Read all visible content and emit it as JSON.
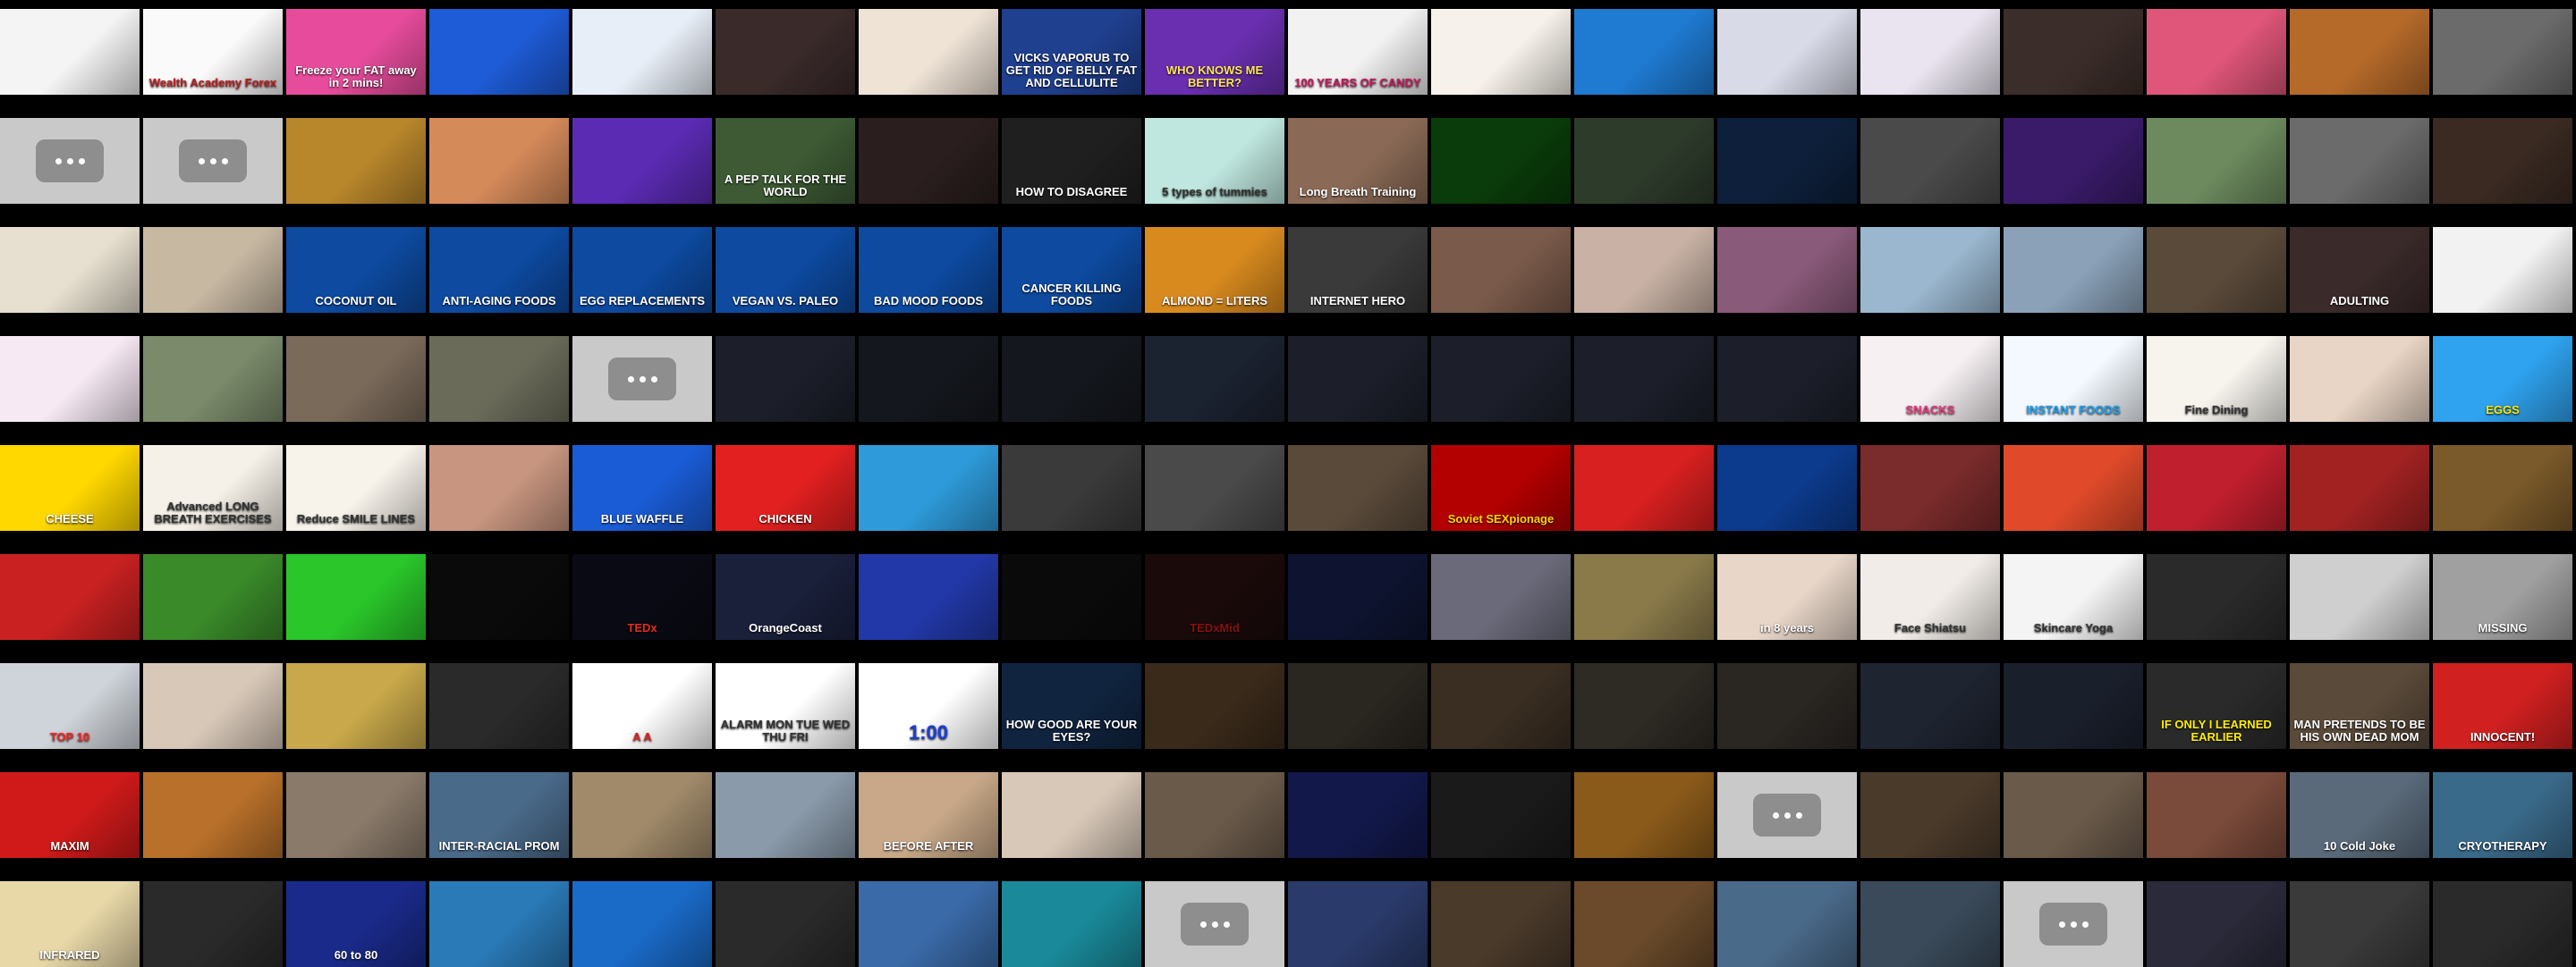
{
  "rows": [
    [
      {
        "kind": "img",
        "bg": "#f4f4f4",
        "fg": "#1a1a1a",
        "cap": "",
        "accent": "#c0392b"
      },
      {
        "kind": "img",
        "bg": "#fafafa",
        "fg": "#b71c1c",
        "cap": "Wealth Academy Forex"
      },
      {
        "kind": "img",
        "bg": "#e74c9c",
        "fg": "#ffffff",
        "cap": "Freeze your FAT away in 2 mins!"
      },
      {
        "kind": "img",
        "bg": "#1e5bd6",
        "fg": "#ffffff",
        "cap": ""
      },
      {
        "kind": "img",
        "bg": "#e8eef7",
        "fg": "#1e5bd6",
        "cap": ""
      },
      {
        "kind": "img",
        "bg": "#3a2a2a",
        "fg": "#ffffff",
        "cap": ""
      },
      {
        "kind": "img",
        "bg": "#efe3d6",
        "fg": "#5a3a1a",
        "cap": ""
      },
      {
        "kind": "img",
        "bg": "#1f3f8f",
        "fg": "#ffffff",
        "cap": "VICKS VAPORUB TO GET RID OF BELLY FAT AND CELLULITE"
      },
      {
        "kind": "img",
        "bg": "#6a2fb0",
        "fg": "#ffe45c",
        "cap": "WHO KNOWS ME BETTER?"
      },
      {
        "kind": "img",
        "bg": "#f2f2f2",
        "fg": "#c2185b",
        "cap": "100 YEARS OF CANDY"
      },
      {
        "kind": "img",
        "bg": "#f6f1ea",
        "fg": "#333333",
        "cap": ""
      },
      {
        "kind": "img",
        "bg": "#1f7ad1",
        "fg": "#ffffff",
        "cap": ""
      },
      {
        "kind": "img",
        "bg": "#d8dae8",
        "fg": "#222222",
        "cap": ""
      },
      {
        "kind": "img",
        "bg": "#e9e4ef",
        "fg": "#222222",
        "cap": ""
      },
      {
        "kind": "img",
        "bg": "#3b2d2a",
        "fg": "#ffd400",
        "cap": ""
      },
      {
        "kind": "img",
        "bg": "#e0567a",
        "fg": "#ffffff",
        "cap": ""
      },
      {
        "kind": "img",
        "bg": "#b56a2a",
        "fg": "#ffffff",
        "cap": ""
      },
      {
        "kind": "img",
        "bg": "#6b6b6b",
        "fg": "#ffffff",
        "cap": ""
      }
    ],
    [
      {
        "kind": "placeholder"
      },
      {
        "kind": "placeholder"
      },
      {
        "kind": "img",
        "bg": "#b8862b",
        "fg": "#ffffff",
        "cap": ""
      },
      {
        "kind": "img",
        "bg": "#d58a5a",
        "fg": "#ffffff",
        "cap": ""
      },
      {
        "kind": "img",
        "bg": "#5b2bb3",
        "fg": "#ffffff",
        "cap": ""
      },
      {
        "kind": "img",
        "bg": "#3d5a34",
        "fg": "#ffffff",
        "cap": "A PEP TALK FOR THE WORLD"
      },
      {
        "kind": "img",
        "bg": "#2a1e1e",
        "fg": "#ff7a00",
        "cap": ""
      },
      {
        "kind": "img",
        "bg": "#1f1f1f",
        "fg": "#ffffff",
        "cap": "HOW TO DISAGREE"
      },
      {
        "kind": "img",
        "bg": "#bfe7df",
        "fg": "#333333",
        "cap": "5 types of tummies"
      },
      {
        "kind": "img",
        "bg": "#8a6a56",
        "fg": "#ffffff",
        "cap": "Long Breath Training"
      },
      {
        "kind": "img",
        "bg": "#0a3b0a",
        "fg": "#37ff37",
        "cap": ""
      },
      {
        "kind": "img",
        "bg": "#2d3b2b",
        "fg": "#ffffff",
        "cap": ""
      },
      {
        "kind": "img",
        "bg": "#0d1f3a",
        "fg": "#6fb3ff",
        "cap": ""
      },
      {
        "kind": "img",
        "bg": "#4a4a4a",
        "fg": "#ffffff",
        "cap": ""
      },
      {
        "kind": "img",
        "bg": "#3a1b6a",
        "fg": "#c59bff",
        "cap": ""
      },
      {
        "kind": "img",
        "bg": "#6c8a5e",
        "fg": "#ffffff",
        "cap": ""
      },
      {
        "kind": "img",
        "bg": "#6b6b6b",
        "fg": "#ffffff",
        "cap": ""
      },
      {
        "kind": "img",
        "bg": "#3a2a22",
        "fg": "#ffffff",
        "cap": ""
      }
    ],
    [
      {
        "kind": "img",
        "bg": "#e7e0d0",
        "fg": "#333333",
        "cap": ""
      },
      {
        "kind": "img",
        "bg": "#c7b8a2",
        "fg": "#333333",
        "cap": ""
      },
      {
        "kind": "img",
        "bg": "#0d4aa0",
        "fg": "#ffffff",
        "cap": "COCONUT OIL"
      },
      {
        "kind": "img",
        "bg": "#0d4aa0",
        "fg": "#ffffff",
        "cap": "ANTI-AGING FOODS"
      },
      {
        "kind": "img",
        "bg": "#0d4aa0",
        "fg": "#ffffff",
        "cap": "EGG REPLACEMENTS"
      },
      {
        "kind": "img",
        "bg": "#0d4aa0",
        "fg": "#ffffff",
        "cap": "VEGAN VS. PALEO"
      },
      {
        "kind": "img",
        "bg": "#0d4aa0",
        "fg": "#ffffff",
        "cap": "BAD MOOD FOODS"
      },
      {
        "kind": "img",
        "bg": "#0d4aa0",
        "fg": "#ffffff",
        "cap": "CANCER KILLING FOODS"
      },
      {
        "kind": "img",
        "bg": "#d88a1e",
        "fg": "#ffffff",
        "cap": "ALMOND = LITERS"
      },
      {
        "kind": "img",
        "bg": "#3a3a3a",
        "fg": "#ffffff",
        "cap": "INTERNET HERO"
      },
      {
        "kind": "img",
        "bg": "#7a5a4a",
        "fg": "#ffffff",
        "cap": ""
      },
      {
        "kind": "img",
        "bg": "#c9b2a5",
        "fg": "#ffffff",
        "cap": ""
      },
      {
        "kind": "img",
        "bg": "#8a5a7a",
        "fg": "#ffffff",
        "cap": ""
      },
      {
        "kind": "img",
        "bg": "#9ab7cf",
        "fg": "#ffffff",
        "cap": ""
      },
      {
        "kind": "img",
        "bg": "#8aa1b8",
        "fg": "#ffffff",
        "cap": ""
      },
      {
        "kind": "img",
        "bg": "#5a4a3a",
        "fg": "#ffffff",
        "cap": ""
      },
      {
        "kind": "img",
        "bg": "#3a2a2a",
        "fg": "#ffffff",
        "cap": "ADULTING"
      },
      {
        "kind": "img",
        "bg": "#f2f2f2",
        "fg": "#d00000",
        "cap": ""
      }
    ],
    [
      {
        "kind": "img",
        "bg": "#f6e9f4",
        "fg": "#c2185b",
        "cap": ""
      },
      {
        "kind": "img",
        "bg": "#7a8a6a",
        "fg": "#ffffff",
        "cap": ""
      },
      {
        "kind": "img",
        "bg": "#7a6a5a",
        "fg": "#ffffff",
        "cap": ""
      },
      {
        "kind": "img",
        "bg": "#6b6b5a",
        "fg": "#ffffff",
        "cap": ""
      },
      {
        "kind": "placeholder"
      },
      {
        "kind": "img",
        "bg": "#1c1f2a",
        "fg": "#ffffff",
        "cap": ""
      },
      {
        "kind": "img",
        "bg": "#14171d",
        "fg": "#ffffff",
        "cap": ""
      },
      {
        "kind": "img",
        "bg": "#14171d",
        "fg": "#ffffff",
        "cap": ""
      },
      {
        "kind": "img",
        "bg": "#1b2230",
        "fg": "#ffffff",
        "cap": ""
      },
      {
        "kind": "img",
        "bg": "#1c1f2a",
        "fg": "#ffffff",
        "cap": ""
      },
      {
        "kind": "img",
        "bg": "#1c1f2a",
        "fg": "#ffffff",
        "cap": ""
      },
      {
        "kind": "img",
        "bg": "#1c1f2a",
        "fg": "#ffffff",
        "cap": ""
      },
      {
        "kind": "img",
        "bg": "#1c1f2a",
        "fg": "#ffffff",
        "cap": ""
      },
      {
        "kind": "img",
        "bg": "#f6f0f3",
        "fg": "#e73a7d",
        "cap": "SNACKS"
      },
      {
        "kind": "img",
        "bg": "#f3f9ff",
        "fg": "#1da1f2",
        "cap": "INSTANT FOODS"
      },
      {
        "kind": "img",
        "bg": "#f7f4ee",
        "fg": "#333333",
        "cap": "Fine Dining"
      },
      {
        "kind": "img",
        "bg": "#e9d5c5",
        "fg": "#333333",
        "cap": ""
      },
      {
        "kind": "img",
        "bg": "#2fa3f0",
        "fg": "#ffea00",
        "cap": "EGGS"
      }
    ],
    [
      {
        "kind": "img",
        "bg": "#ffd800",
        "fg": "#ffffff",
        "cap": "CHEESE"
      },
      {
        "kind": "img",
        "bg": "#f6f1e8",
        "fg": "#333333",
        "cap": "Advanced LONG BREATH EXERCISES"
      },
      {
        "kind": "img",
        "bg": "#f7f2ea",
        "fg": "#333333",
        "cap": "Reduce SMILE LINES"
      },
      {
        "kind": "img",
        "bg": "#c89680",
        "fg": "#ffffff",
        "cap": ""
      },
      {
        "kind": "img",
        "bg": "#1a5cd6",
        "fg": "#ffffff",
        "cap": "BLUE WAFFLE"
      },
      {
        "kind": "img",
        "bg": "#e32020",
        "fg": "#ffffff",
        "cap": "CHICKEN"
      },
      {
        "kind": "img",
        "bg": "#2e9ad9",
        "fg": "#ffffff",
        "cap": ""
      },
      {
        "kind": "img",
        "bg": "#3a3a3a",
        "fg": "#ffffff",
        "cap": ""
      },
      {
        "kind": "img",
        "bg": "#4a4a4a",
        "fg": "#ffffff",
        "cap": ""
      },
      {
        "kind": "img",
        "bg": "#5a4a3a",
        "fg": "#ffffff",
        "cap": ""
      },
      {
        "kind": "img",
        "bg": "#b30000",
        "fg": "#ffd400",
        "cap": "Soviet SEXpionage"
      },
      {
        "kind": "img",
        "bg": "#d82020",
        "fg": "#ffffff",
        "cap": ""
      },
      {
        "kind": "img",
        "bg": "#0c3a8c",
        "fg": "#ffffff",
        "cap": ""
      },
      {
        "kind": "img",
        "bg": "#7a2b2b",
        "fg": "#ffffff",
        "cap": ""
      },
      {
        "kind": "img",
        "bg": "#e04a2a",
        "fg": "#ffffff",
        "cap": ""
      },
      {
        "kind": "img",
        "bg": "#c01f2d",
        "fg": "#ffffff",
        "cap": ""
      },
      {
        "kind": "img",
        "bg": "#a22222",
        "fg": "#ffffff",
        "cap": ""
      },
      {
        "kind": "img",
        "bg": "#7a5a2a",
        "fg": "#ffffff",
        "cap": ""
      }
    ],
    [
      {
        "kind": "img",
        "bg": "#c92121",
        "fg": "#ffffff",
        "cap": ""
      },
      {
        "kind": "img",
        "bg": "#3a8a2a",
        "fg": "#ffffff",
        "cap": ""
      },
      {
        "kind": "img",
        "bg": "#2ac62a",
        "fg": "#ffffff",
        "cap": ""
      },
      {
        "kind": "img",
        "bg": "#0a0a0a",
        "fg": "#ffffff",
        "cap": ""
      },
      {
        "kind": "img",
        "bg": "#0a0a14",
        "fg": "#e62b1e",
        "cap": "TEDx"
      },
      {
        "kind": "img",
        "bg": "#1a1f3a",
        "fg": "#ffffff",
        "cap": "OrangeCoast"
      },
      {
        "kind": "img",
        "bg": "#2238a8",
        "fg": "#ffffff",
        "cap": ""
      },
      {
        "kind": "img",
        "bg": "#0a0a0a",
        "fg": "#ffffff",
        "cap": ""
      },
      {
        "kind": "img",
        "bg": "#1a0a0a",
        "fg": "#8a1010",
        "cap": "TEDxMid"
      },
      {
        "kind": "img",
        "bg": "#0e1430",
        "fg": "#ffffff",
        "cap": ""
      },
      {
        "kind": "img",
        "bg": "#6a6a7a",
        "fg": "#ffffff",
        "cap": ""
      },
      {
        "kind": "img",
        "bg": "#8a7a4a",
        "fg": "#ffffff",
        "cap": ""
      },
      {
        "kind": "img",
        "bg": "#e8d6c8",
        "fg": "#ffffff",
        "cap": "in 8 years"
      },
      {
        "kind": "img",
        "bg": "#f1ece7",
        "fg": "#333333",
        "cap": "Face Shiatsu"
      },
      {
        "kind": "img",
        "bg": "#f4f4f4",
        "fg": "#333333",
        "cap": "Skincare Yoga"
      },
      {
        "kind": "img",
        "bg": "#2a2a2a",
        "fg": "#ffffff",
        "cap": ""
      },
      {
        "kind": "img",
        "bg": "#cfcfcf",
        "fg": "#333333",
        "cap": ""
      },
      {
        "kind": "img",
        "bg": "#a0a0a0",
        "fg": "#ffffff",
        "cap": "MISSING"
      }
    ],
    [
      {
        "kind": "img",
        "bg": "#cfd4da",
        "fg": "#ff2020",
        "cap": "TOP 10"
      },
      {
        "kind": "img",
        "bg": "#d8c8b8",
        "fg": "#ffffff",
        "cap": ""
      },
      {
        "kind": "img",
        "bg": "#c8a84a",
        "fg": "#ffffff",
        "cap": ""
      },
      {
        "kind": "img",
        "bg": "#2a2a2a",
        "fg": "#ffffff",
        "cap": ""
      },
      {
        "kind": "img",
        "bg": "#ffffff",
        "fg": "#e32020",
        "cap": "A A"
      },
      {
        "kind": "img",
        "bg": "#ffffff",
        "fg": "#333333",
        "cap": "ALARM MON TUE WED THU FRI"
      },
      {
        "kind": "img",
        "bg": "#ffffff",
        "fg": "#1a3ed6",
        "cap": "1:00",
        "big": true
      },
      {
        "kind": "img",
        "bg": "#10243f",
        "fg": "#ffffff",
        "cap": "HOW GOOD ARE YOUR EYES?"
      },
      {
        "kind": "img",
        "bg": "#3a2a1a",
        "fg": "#ffffff",
        "cap": ""
      },
      {
        "kind": "img",
        "bg": "#2a2620",
        "fg": "#ffffff",
        "cap": ""
      },
      {
        "kind": "img",
        "bg": "#3a2e22",
        "fg": "#ffffff",
        "cap": ""
      },
      {
        "kind": "img",
        "bg": "#2e2a24",
        "fg": "#ffffff",
        "cap": ""
      },
      {
        "kind": "img",
        "bg": "#2a2622",
        "fg": "#ffffff",
        "cap": ""
      },
      {
        "kind": "img",
        "bg": "#1e2430",
        "fg": "#ffffff",
        "cap": ""
      },
      {
        "kind": "img",
        "bg": "#1a1f2c",
        "fg": "#ffffff",
        "cap": ""
      },
      {
        "kind": "img",
        "bg": "#2a2a2a",
        "fg": "#ffee00",
        "cap": "IF ONLY I LEARNED EARLIER"
      },
      {
        "kind": "img",
        "bg": "#5a4a3a",
        "fg": "#ffffff",
        "cap": "MAN PRETENDS TO BE HIS OWN DEAD MOM"
      },
      {
        "kind": "img",
        "bg": "#d02020",
        "fg": "#ffffff",
        "cap": "INNOCENT!"
      }
    ],
    [
      {
        "kind": "img",
        "bg": "#d01a1a",
        "fg": "#ffffff",
        "cap": "MAXIM"
      },
      {
        "kind": "img",
        "bg": "#b8702a",
        "fg": "#ffffff",
        "cap": ""
      },
      {
        "kind": "img",
        "bg": "#8a7a6a",
        "fg": "#ffffff",
        "cap": ""
      },
      {
        "kind": "img",
        "bg": "#4a6a8a",
        "fg": "#ffffff",
        "cap": "INTER-RACIAL PROM"
      },
      {
        "kind": "img",
        "bg": "#a08a6a",
        "fg": "#ffffff",
        "cap": ""
      },
      {
        "kind": "img",
        "bg": "#8a9aaa",
        "fg": "#ffffff",
        "cap": ""
      },
      {
        "kind": "img",
        "bg": "#c8a888",
        "fg": "#ffffff",
        "cap": "BEFORE AFTER"
      },
      {
        "kind": "img",
        "bg": "#d8c8b8",
        "fg": "#ffffff",
        "cap": ""
      },
      {
        "kind": "img",
        "bg": "#6a5a4a",
        "fg": "#ffffff",
        "cap": ""
      },
      {
        "kind": "img",
        "bg": "#12184a",
        "fg": "#ffffff",
        "cap": ""
      },
      {
        "kind": "img",
        "bg": "#1a1a1a",
        "fg": "#ffffff",
        "cap": ""
      },
      {
        "kind": "img",
        "bg": "#8a5a1a",
        "fg": "#ffffff",
        "cap": ""
      },
      {
        "kind": "placeholder"
      },
      {
        "kind": "img",
        "bg": "#4a3a2a",
        "fg": "#ffffff",
        "cap": ""
      },
      {
        "kind": "img",
        "bg": "#6a5a4a",
        "fg": "#ffffff",
        "cap": ""
      },
      {
        "kind": "img",
        "bg": "#7a4a3a",
        "fg": "#ffffff",
        "cap": ""
      },
      {
        "kind": "img",
        "bg": "#5a6a7a",
        "fg": "#ffffff",
        "cap": "10 Cold Joke"
      },
      {
        "kind": "img",
        "bg": "#3a6a8a",
        "fg": "#ffffff",
        "cap": "CRYOTHERAPY"
      }
    ],
    [
      {
        "kind": "img",
        "bg": "#e8d8a8",
        "fg": "#ffffff",
        "cap": "INFRARED"
      },
      {
        "kind": "img",
        "bg": "#2a2a2a",
        "fg": "#ffffff",
        "cap": ""
      },
      {
        "kind": "img",
        "bg": "#1a2a8a",
        "fg": "#ffffff",
        "cap": "60 to 80"
      },
      {
        "kind": "img",
        "bg": "#2a7ab8",
        "fg": "#ffffff",
        "cap": ""
      },
      {
        "kind": "img",
        "bg": "#1a6ac8",
        "fg": "#ffffff",
        "cap": ""
      },
      {
        "kind": "img",
        "bg": "#2a2a2a",
        "fg": "#ffffff",
        "cap": ""
      },
      {
        "kind": "img",
        "bg": "#3a6aa8",
        "fg": "#ffffff",
        "cap": ""
      },
      {
        "kind": "img",
        "bg": "#1a8a9a",
        "fg": "#ffffff",
        "cap": ""
      },
      {
        "kind": "placeholder"
      },
      {
        "kind": "img",
        "bg": "#2a3a6a",
        "fg": "#ffffff",
        "cap": ""
      },
      {
        "kind": "img",
        "bg": "#4a3a2a",
        "fg": "#ffffff",
        "cap": ""
      },
      {
        "kind": "img",
        "bg": "#6a4a2a",
        "fg": "#ffffff",
        "cap": ""
      },
      {
        "kind": "img",
        "bg": "#4a6a8a",
        "fg": "#ffffff",
        "cap": ""
      },
      {
        "kind": "img",
        "bg": "#3a4a5a",
        "fg": "#ffffff",
        "cap": ""
      },
      {
        "kind": "placeholder"
      },
      {
        "kind": "img",
        "bg": "#2a2a3a",
        "fg": "#ffffff",
        "cap": ""
      },
      {
        "kind": "img",
        "bg": "#3a3a3a",
        "fg": "#ffffff",
        "cap": ""
      },
      {
        "kind": "img",
        "bg": "#2a2a2a",
        "fg": "#ffffff",
        "cap": ""
      }
    ]
  ]
}
